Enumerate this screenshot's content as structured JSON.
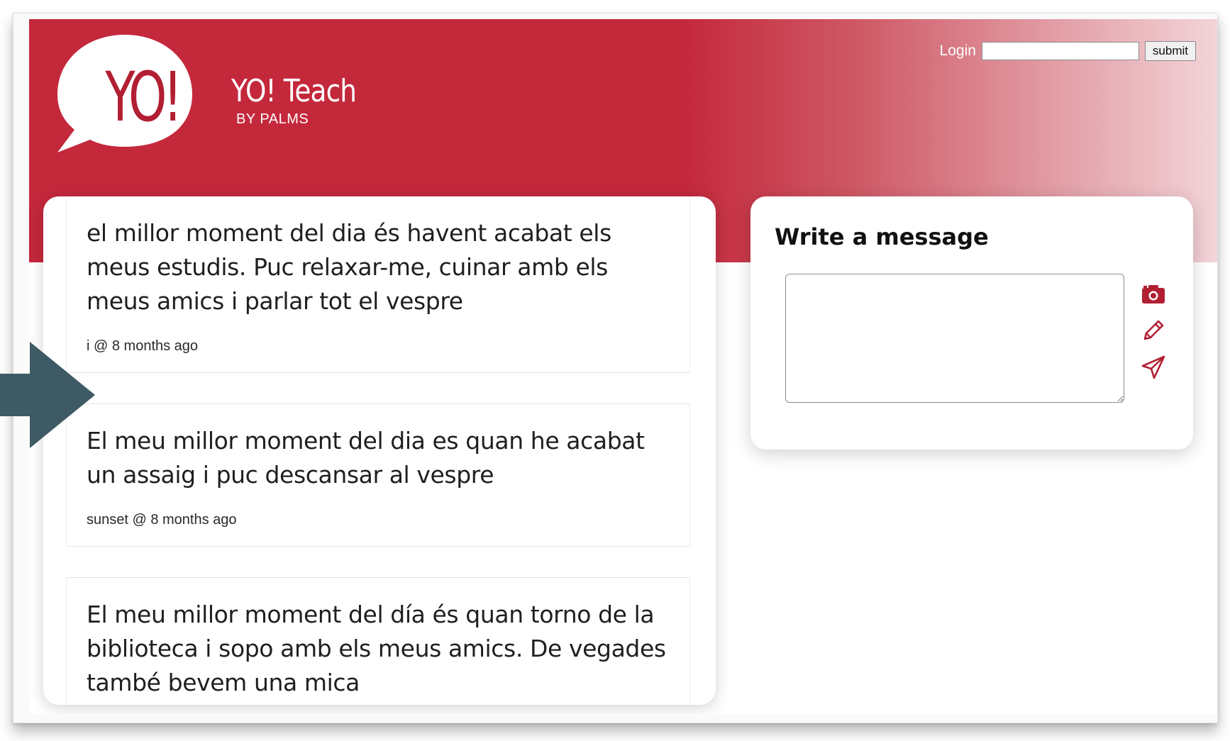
{
  "brand": {
    "logo_text": "YO!",
    "name": "YO! Teach",
    "subtitle": "BY PALMS"
  },
  "login": {
    "label": "Login",
    "input_value": "",
    "submit_label": "submit"
  },
  "messages": [
    {
      "text": "el millor moment del dia és havent acabat els meus estudis. Puc relaxar-me, cuinar amb els meus amics i parlar tot el vespre",
      "meta": "i @ 8 months ago"
    },
    {
      "text": "El meu millor moment del dia es quan he acabat un assaig i puc descansar al vespre",
      "meta": "sunset @ 8 months ago"
    },
    {
      "text": "El meu millor moment del día és quan torno de la biblioteca i sopo amb els meus amics. De vegades també bevem una mica",
      "meta": ""
    }
  ],
  "compose": {
    "title": "Write a message",
    "textarea_value": "",
    "actions": [
      {
        "icon": "camera-icon"
      },
      {
        "icon": "pencil-icon"
      },
      {
        "icon": "send-icon"
      }
    ]
  },
  "colors": {
    "brand_red": "#c4283b",
    "icon_red": "#b21f33",
    "arrow": "#3e5a64"
  }
}
